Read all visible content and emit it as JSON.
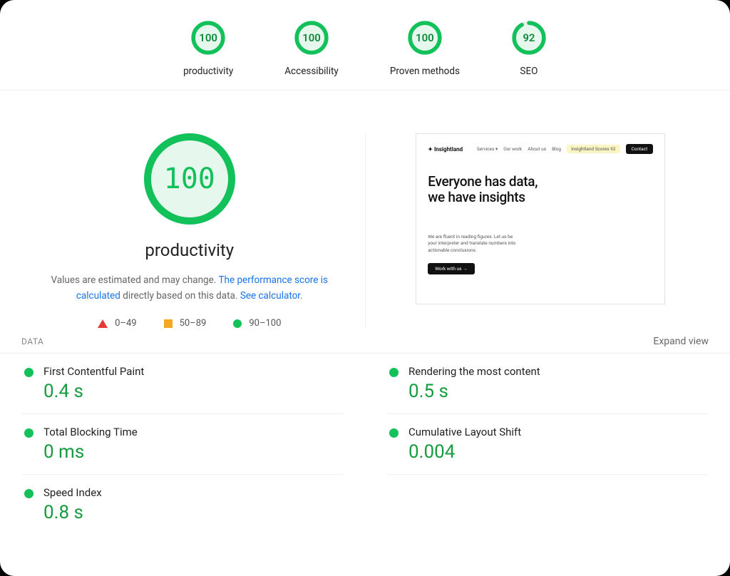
{
  "top_gauges": [
    {
      "score": "100",
      "label": "productivity",
      "percent": 100
    },
    {
      "score": "100",
      "label": "Accessibility",
      "percent": 100
    },
    {
      "score": "100",
      "label": "Proven methods",
      "percent": 100
    },
    {
      "score": "92",
      "label": "SEO",
      "percent": 92
    }
  ],
  "main": {
    "score": "100",
    "title": "productivity",
    "desc_pre": "Values are estimated and may change. ",
    "desc_link1": "The performance score is calculated",
    "desc_mid": " directly based on this data. ",
    "desc_link2": "See calculator",
    "desc_post": "."
  },
  "legend": {
    "low": "0–49",
    "mid": "50–89",
    "high": "90–100"
  },
  "preview": {
    "logo": "✦ Insightland",
    "nav": [
      "Services ▾",
      "Our work",
      "About us",
      "Blog"
    ],
    "pill": "Insightland Scores 92",
    "contact": "Contact",
    "hero1": "Everyone has data,",
    "hero2": "we have insights",
    "sub": "We are fluent in reading figures. Let us be your interpreter and translate numbers into actionable conclusions.",
    "cta": "Work with us →"
  },
  "data_section": {
    "label": "DATA",
    "expand": "Expand view"
  },
  "metrics": [
    {
      "label": "First Contentful Paint",
      "value": "0.4 s"
    },
    {
      "label": "Rendering the most content",
      "value": "0.5 s"
    },
    {
      "label": "Total Blocking Time",
      "value": "0 ms"
    },
    {
      "label": "Cumulative Layout Shift",
      "value": "0.004"
    },
    {
      "label": "Speed Index",
      "value": "0.8 s"
    }
  ],
  "colors": {
    "green": "#13c15b",
    "green_dark": "#0a8a3a",
    "orange": "#f5a623",
    "red": "#e53935",
    "link": "#1a73e8"
  }
}
